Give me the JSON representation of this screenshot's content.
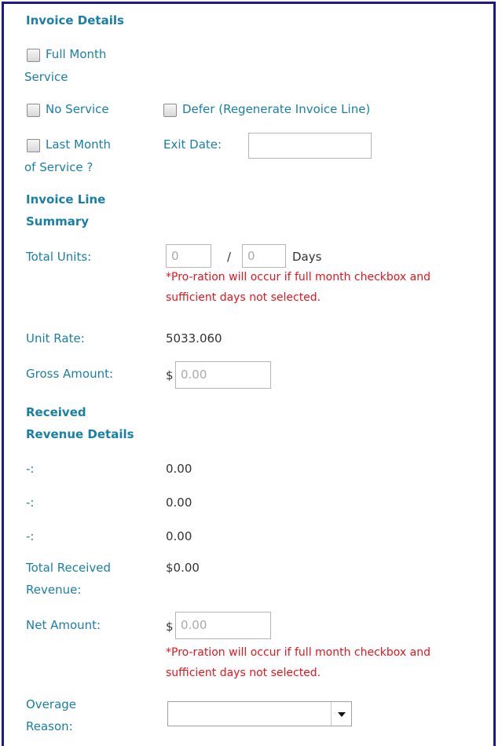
{
  "invoice_details": {
    "heading": "Invoice Details",
    "full_month_label_1": "Full Month",
    "full_month_label_2": "Service",
    "no_service_label": "No Service",
    "defer_label": "Defer (Regenerate Invoice Line)",
    "last_month_label_1": "Last Month",
    "last_month_label_2": "of Service ?",
    "exit_date_label": "Exit Date:",
    "exit_date_value": ""
  },
  "invoice_line_summary": {
    "heading_1": "Invoice Line",
    "heading_2": "Summary",
    "total_units_label": "Total Units:",
    "total_units_value": "0",
    "total_units_separator": "/",
    "total_days_value": "0",
    "days_label": "Days",
    "proration_note_1": "*Pro-ration will occur if full month checkbox and",
    "proration_note_2": "sufficient days not selected.",
    "unit_rate_label": "Unit Rate:",
    "unit_rate_value": "5033.060",
    "gross_amount_label": "Gross Amount:",
    "gross_currency": "$",
    "gross_amount_value": "0.00"
  },
  "received_revenue": {
    "heading_1": "Received",
    "heading_2": "Revenue Details",
    "rows": [
      {
        "label": "-:",
        "value": "0.00"
      },
      {
        "label": "-:",
        "value": "0.00"
      },
      {
        "label": "-:",
        "value": "0.00"
      }
    ],
    "total_label_1": "Total Received",
    "total_label_2": "Revenue:",
    "total_value": "$0.00",
    "net_amount_label": "Net Amount:",
    "net_currency": "$",
    "net_amount_value": "0.00",
    "proration_note_1": "*Pro-ration will occur if full month checkbox and",
    "proration_note_2": "sufficient days not selected.",
    "overage_label_1": "Overage",
    "overage_label_2": "Reason:",
    "overage_value": ""
  },
  "colors": {
    "label": "#1a7fa6",
    "warning": "#e8141c",
    "border": "#1a1a8c"
  }
}
